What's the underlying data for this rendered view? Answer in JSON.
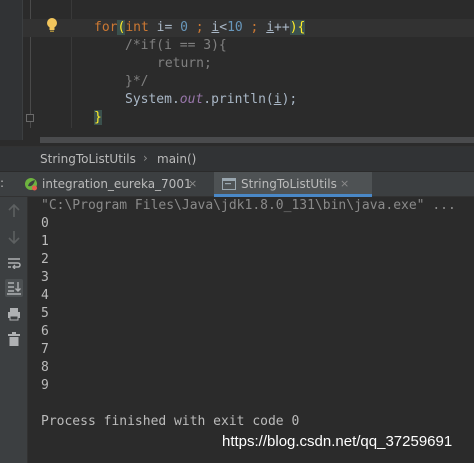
{
  "editor": {
    "lines": {
      "for_kw": "for",
      "int_kw": "int",
      "for_rest_a": " i= ",
      "num_0": "0",
      "semi_a": " ; ",
      "i_b": "i",
      "lt": "<",
      "num_10": "10",
      "semi_b": " ; ",
      "i_c": "i",
      "pp": "++",
      "comment_1": "/*if(i == 3){",
      "comment_2": "return;",
      "comment_3": "}*/",
      "sys_a": "System.",
      "sys_out": "out",
      "sys_b": ".println(",
      "sys_i": "i",
      "sys_c": ");",
      "close_brace": "}"
    }
  },
  "breadcrumb": {
    "class_name": "StringToListUtils",
    "separator": "›",
    "method_name": "main()"
  },
  "run_tabs": {
    "left_marker": ":",
    "tabs": [
      {
        "label": "integration_eureka_7001",
        "icon": "spring-boot-icon",
        "close": "×"
      },
      {
        "label": "StringToListUtils",
        "icon": "console-app-icon",
        "close": "×"
      }
    ]
  },
  "console": {
    "command": "\"C:\\Program Files\\Java\\jdk1.8.0_131\\bin\\java.exe\" ...",
    "output": [
      "0",
      "1",
      "2",
      "3",
      "4",
      "5",
      "6",
      "7",
      "8",
      "9"
    ],
    "exit_message": "Process finished with exit code 0"
  },
  "toolbar_icons": [
    "up-arrow-icon",
    "down-arrow-icon",
    "soft-wrap-icon",
    "scroll-to-end-icon",
    "print-icon",
    "trash-icon"
  ],
  "watermark": "https://blog.csdn.net/qq_37259691",
  "colors": {
    "background": "#2b2b2b",
    "keyword": "#cc7832",
    "number": "#6897bb",
    "comment": "#808080",
    "static_field": "#9876aa",
    "brace_match": "#ffef28",
    "active_tab_underline": "#4a88c7"
  }
}
